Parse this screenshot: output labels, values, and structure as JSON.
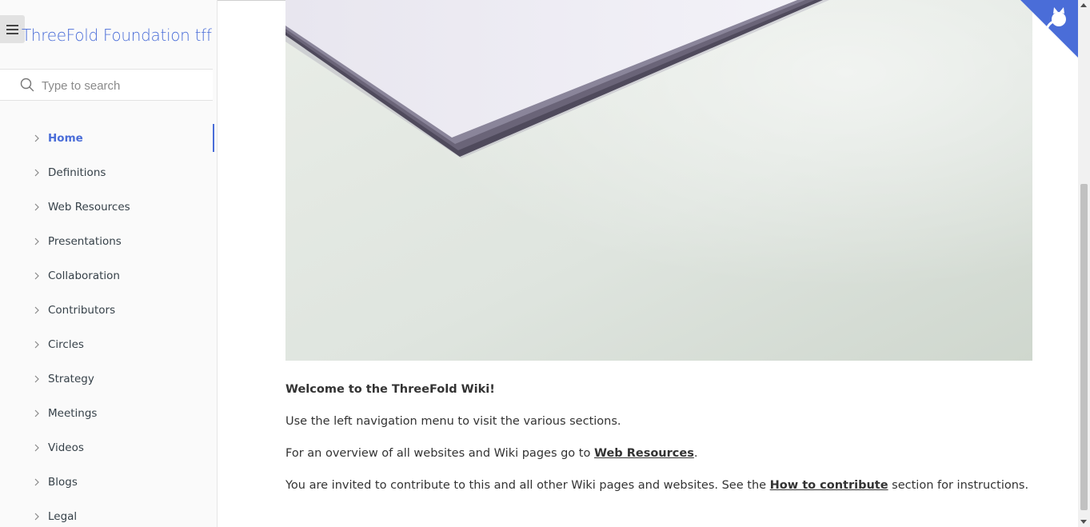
{
  "sidebar": {
    "site_title": "ThreeFold Foundation tff",
    "search_placeholder": "Type to search",
    "items": [
      {
        "label": "Home",
        "active": true
      },
      {
        "label": "Definitions"
      },
      {
        "label": "Web Resources"
      },
      {
        "label": "Presentations"
      },
      {
        "label": "Collaboration"
      },
      {
        "label": "Contributors"
      },
      {
        "label": "Circles"
      },
      {
        "label": "Strategy"
      },
      {
        "label": "Meetings"
      },
      {
        "label": "Videos"
      },
      {
        "label": "Blogs"
      },
      {
        "label": "Legal"
      }
    ]
  },
  "main": {
    "welcome": "Welcome to the ThreeFold Wiki!",
    "para1": "Use the left navigation menu to visit the various sections.",
    "para2_before": "For an overview of all websites and Wiki pages go to ",
    "para2_link": "Web Resources",
    "para2_after": ".",
    "para3_before": "You are invited to contribute to this and all other Wiki pages and websites. See the ",
    "para3_link": "How to contribute",
    "para3_after": " section for instructions."
  },
  "colors": {
    "accent": "#4a6dd8",
    "corner": "#4a6dd8",
    "text": "#364149"
  },
  "icons": {
    "menu": "hamburger-icon",
    "search": "search-icon",
    "chevron": "chevron-right-icon",
    "corner": "github-octocat-icon"
  }
}
